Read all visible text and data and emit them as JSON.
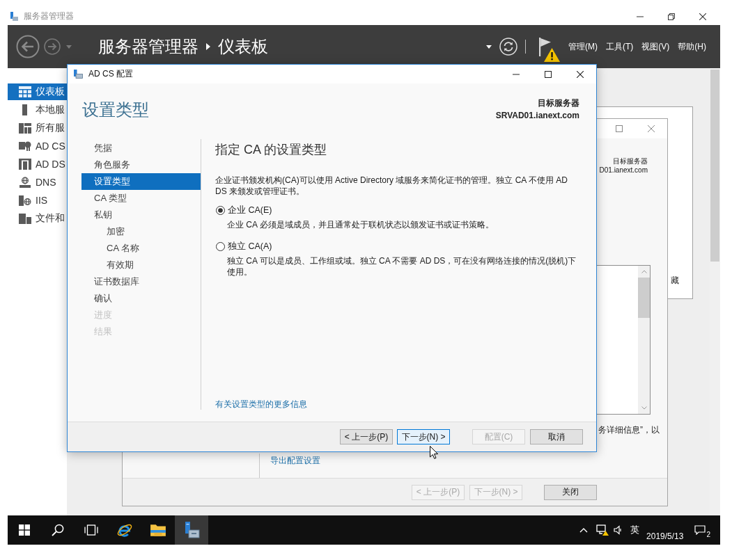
{
  "window": {
    "title": "服务器管理器"
  },
  "header": {
    "breadcrumb": [
      "服务器管理器",
      "仪表板"
    ],
    "notification_warning": true,
    "menus": [
      "管理(M)",
      "工具(T)",
      "视图(V)",
      "帮助(H)"
    ]
  },
  "sidebar": {
    "items": [
      {
        "label": "仪表板",
        "selected": true
      },
      {
        "label": "本地服",
        "selected": false
      },
      {
        "label": "所有服",
        "selected": false
      },
      {
        "label": "AD CS",
        "selected": false
      },
      {
        "label": "AD DS",
        "selected": false
      },
      {
        "label": "DNS",
        "selected": false
      },
      {
        "label": "IIS",
        "selected": false
      },
      {
        "label": "文件和",
        "selected": false
      }
    ]
  },
  "back_panel": {
    "text": "藏"
  },
  "roles_wizard": {
    "target_label": "目标服务器",
    "target_server": "D01.ianext.com",
    "text_fragment": "务详细信息”，以",
    "link": "导出配置设置",
    "buttons": [
      {
        "label": "< 上一步(P)",
        "disabled": true
      },
      {
        "label": "下一步(N) >",
        "disabled": true
      },
      {
        "label": "关闭",
        "disabled": false
      }
    ]
  },
  "dialog": {
    "title": "AD CS 配置",
    "heading": "设置类型",
    "target_label": "目标服务器",
    "target_server": "SRVAD01.ianext.com",
    "steps": [
      {
        "label": "凭据",
        "selected": false,
        "disabled": false
      },
      {
        "label": "角色服务",
        "selected": false,
        "disabled": false
      },
      {
        "label": "设置类型",
        "selected": true,
        "disabled": false
      },
      {
        "label": "CA 类型",
        "selected": false,
        "disabled": false
      },
      {
        "label": "私钥",
        "selected": false,
        "disabled": false,
        "children": [
          {
            "label": "加密",
            "selected": false,
            "disabled": false
          },
          {
            "label": "CA 名称",
            "selected": false,
            "disabled": false
          },
          {
            "label": "有效期",
            "selected": false,
            "disabled": false
          }
        ]
      },
      {
        "label": "证书数据库",
        "selected": false,
        "disabled": false
      },
      {
        "label": "确认",
        "selected": false,
        "disabled": false
      },
      {
        "label": "进度",
        "selected": false,
        "disabled": true
      },
      {
        "label": "结果",
        "selected": false,
        "disabled": true
      }
    ],
    "section_title": "指定 CA 的设置类型",
    "intro": "企业证书颁发机构(CA)可以使用 Active Directory 域服务来简化证书的管理。独立 CA 不使用 AD DS 来颁发或管理证书。",
    "options": [
      {
        "label": "企业 CA(E)",
        "description": "企业 CA 必须是域成员，并且通常处于联机状态以颁发证书或证书策略。",
        "selected": true
      },
      {
        "label": "独立 CA(A)",
        "description": "独立 CA 可以是成员、工作组或域。独立 CA 不需要 AD DS，可在没有网络连接的情况(脱机)下使用。",
        "selected": false
      }
    ],
    "more_info_link": "有关设置类型的更多信息",
    "buttons": [
      {
        "label": "< 上一步(P)",
        "disabled": false,
        "hovered": false
      },
      {
        "label": "下一步(N) >",
        "disabled": false,
        "hovered": true
      },
      {
        "label": "配置(C)",
        "disabled": true,
        "hovered": false
      },
      {
        "label": "取消",
        "disabled": false,
        "hovered": false
      }
    ]
  },
  "taskbar": {
    "apps": [
      {
        "selected": false
      },
      {
        "selected": false
      },
      {
        "selected": true
      }
    ],
    "input_mode": "英",
    "date": "2019/5/13",
    "notification_count": "2"
  }
}
